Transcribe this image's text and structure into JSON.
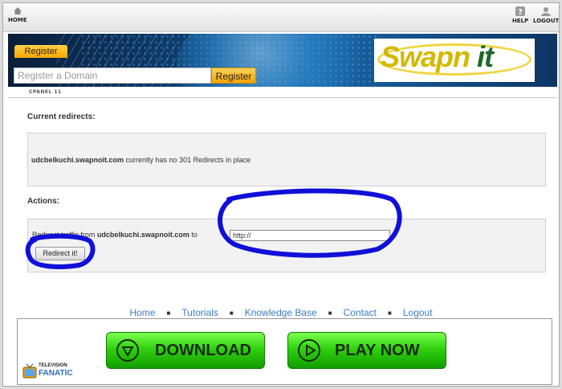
{
  "topbar": {
    "home_label": "HOME",
    "help_label": "HELP",
    "logout_label": "LOGOUT"
  },
  "banner": {
    "register_tab": "Register",
    "domain_placeholder": "Register a Domain",
    "register_button": "Register",
    "logo_part1": "Swapn",
    "logo_part2": "it"
  },
  "cpanel_label": "CPANEL 11",
  "current": {
    "heading": "Current redirects:",
    "domain": "udcbelkuchi.swapnoit.com",
    "message": " currently has no 301 Redirects in place"
  },
  "actions": {
    "heading": "Actions:",
    "prefix": "Redirect traffic from ",
    "domain": "udcbelkuchi.swapnoit.com",
    "suffix": " to",
    "url_value": "http://",
    "button": "Redirect it!"
  },
  "footer": {
    "links": [
      "Home",
      "Tutorials",
      "Knowledge Base",
      "Contact",
      "Logout"
    ],
    "separator": "■"
  },
  "ad": {
    "download_label": "DOWNLOAD",
    "play_label": "PLAY NOW",
    "brand_top": "TELEVISION",
    "brand_bottom": "FANATIC"
  },
  "colors": {
    "annotation_blue": "#1010d8",
    "link_blue": "#3b7cc7",
    "register_orange": "#f3a900",
    "ad_green": "#2fd10e"
  }
}
